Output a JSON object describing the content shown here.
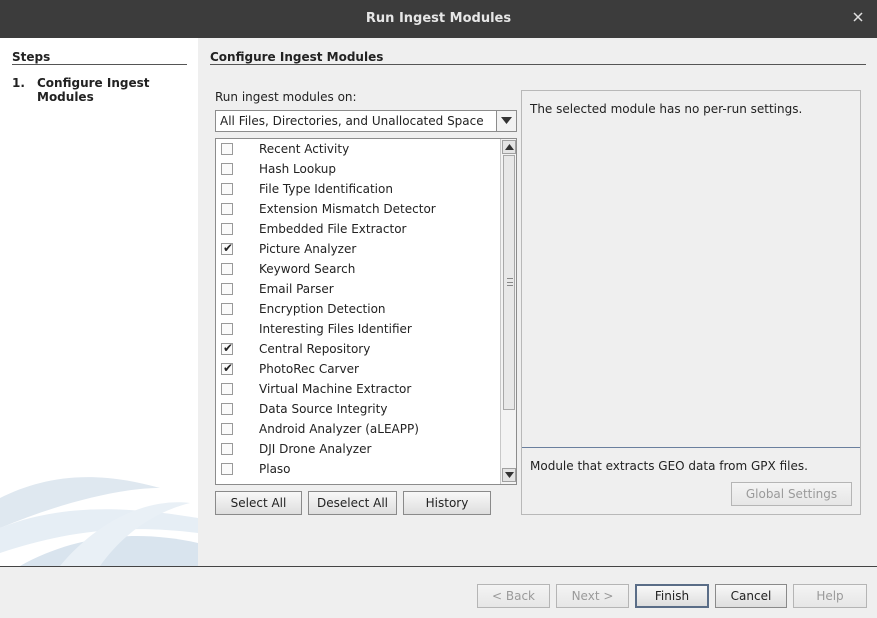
{
  "window": {
    "title": "Run Ingest Modules",
    "close_icon": "close-icon"
  },
  "steps": {
    "header": "Steps",
    "items": [
      {
        "number": "1.",
        "label": "Configure Ingest Modules"
      }
    ]
  },
  "main": {
    "header": "Configure Ingest Modules",
    "run_on_label": "Run ingest modules on:",
    "run_on_value": "All Files, Directories, and Unallocated Space",
    "modules": [
      {
        "label": "Recent Activity",
        "checked": false
      },
      {
        "label": "Hash Lookup",
        "checked": false
      },
      {
        "label": "File Type Identification",
        "checked": false
      },
      {
        "label": "Extension Mismatch Detector",
        "checked": false
      },
      {
        "label": "Embedded File Extractor",
        "checked": false
      },
      {
        "label": "Picture Analyzer",
        "checked": true
      },
      {
        "label": "Keyword Search",
        "checked": false
      },
      {
        "label": "Email Parser",
        "checked": false
      },
      {
        "label": "Encryption Detection",
        "checked": false
      },
      {
        "label": "Interesting Files Identifier",
        "checked": false
      },
      {
        "label": "Central Repository",
        "checked": true
      },
      {
        "label": "PhotoRec Carver",
        "checked": true
      },
      {
        "label": "Virtual Machine Extractor",
        "checked": false
      },
      {
        "label": "Data Source Integrity",
        "checked": false
      },
      {
        "label": "Android Analyzer (aLEAPP)",
        "checked": false
      },
      {
        "label": "DJI Drone Analyzer",
        "checked": false
      },
      {
        "label": "Plaso",
        "checked": false
      }
    ],
    "check_mark": "✔",
    "buttons": {
      "select_all": "Select All",
      "deselect_all": "Deselect All",
      "history": "History"
    },
    "settings_message": "The selected module has no per-run settings.",
    "module_description": "Module that extracts GEO data from GPX files.",
    "global_settings": "Global Settings"
  },
  "footer": {
    "back": "< Back",
    "next": "Next >",
    "finish": "Finish",
    "cancel": "Cancel",
    "help": "Help"
  }
}
